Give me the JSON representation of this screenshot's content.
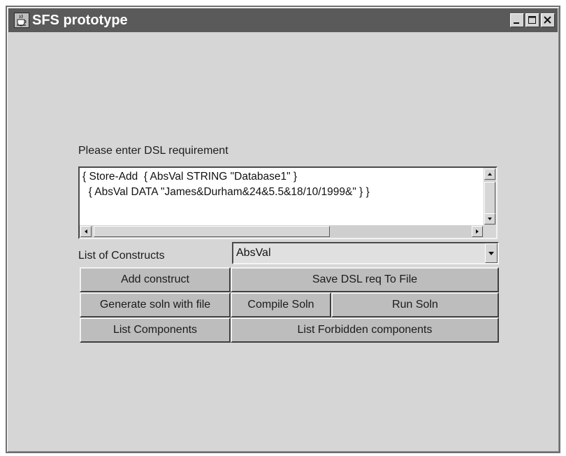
{
  "window": {
    "title": "SFS prototype",
    "icon": "java-cup-icon",
    "controls": [
      "minimize-icon",
      "maximize-icon",
      "close-icon"
    ]
  },
  "requirement": {
    "label": "Please enter DSL requirement",
    "lines": [
      "{ Store-Add  { AbsVal STRING \"Database1\" }",
      "  { AbsVal DATA \"James&Durham&24&5.5&18/10/1999&\" } }"
    ]
  },
  "constructs": {
    "label": "List of Constructs",
    "selected": "AbsVal"
  },
  "buttons": {
    "add_construct": "Add construct",
    "save_dsl": "Save DSL req To File",
    "generate_soln": "Generate soln with file",
    "compile_soln": "Compile Soln",
    "run_soln": "Run Soln",
    "list_components": "List Components",
    "list_forbidden": "List Forbidden components"
  }
}
